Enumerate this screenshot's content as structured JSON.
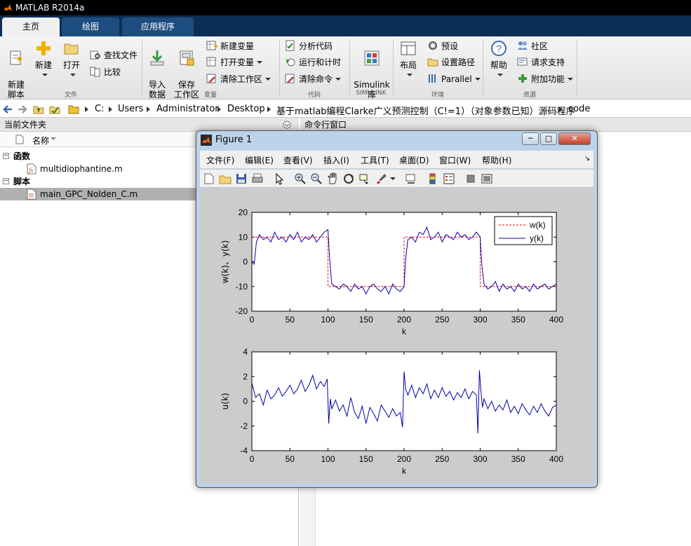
{
  "app": {
    "title": "MATLAB R2014a"
  },
  "tabs": [
    {
      "label": "主页"
    },
    {
      "label": "绘图"
    },
    {
      "label": "应用程序"
    }
  ],
  "ribbon": {
    "groups": {
      "file": "文件",
      "variable": "变量",
      "code": "代码",
      "simulink": "SIMULINK",
      "env": "环境",
      "resources": "资源"
    },
    "new_script": "新建\n脚本",
    "new": "新建",
    "open": "打开",
    "find_files": "查找文件",
    "compare": "比较",
    "import_data": "导入\n数据",
    "save_workspace": "保存\n工作区",
    "new_variable": "新建变量",
    "open_variable": "打开变量",
    "clear_workspace": "清除工作区",
    "analyze_code": "分析代码",
    "run_and_time": "运行和计时",
    "clear_commands": "清除命令",
    "simulink_library": "Simulink\n库",
    "layout": "布局",
    "preferences": "预设",
    "set_path": "设置路径",
    "parallel": "Parallel",
    "help": "帮助",
    "community": "社区",
    "request_support": "请求支持",
    "add_ons": "附加功能"
  },
  "address": {
    "crumbs": [
      "C:",
      "Users",
      "Administrator",
      "Desktop",
      "基于matlab编程Clarke广义预测控制（C!=1）（对象参数已知）源码程序",
      "code"
    ]
  },
  "current_folder": {
    "title": "当前文件夹",
    "col_name": "名称",
    "groups": [
      {
        "label": "函数",
        "files": [
          "multidiophantine.m"
        ]
      },
      {
        "label": "脚本",
        "files": [
          "main_GPC_NoIden_C.m"
        ]
      }
    ]
  },
  "command_window": {
    "title": "命令行窗口"
  },
  "figure": {
    "title": "Figure 1",
    "menus": [
      "文件(F)",
      "编辑(E)",
      "查看(V)",
      "插入(I)",
      "工具(T)",
      "桌面(D)",
      "窗口(W)",
      "帮助(H)"
    ]
  },
  "colors": {
    "tab_bar": "#0b2e55",
    "series_w": "#ff0000",
    "series_y": "#0000aa",
    "series_u": "#0000aa"
  },
  "chart_data": [
    {
      "type": "line",
      "xlabel": "k",
      "ylabel": "w(k)、y(k)",
      "xlim": [
        0,
        400
      ],
      "ylim": [
        -20,
        20
      ],
      "xticks": [
        0,
        50,
        100,
        150,
        200,
        250,
        300,
        350,
        400
      ],
      "yticks": [
        -20,
        -10,
        0,
        10,
        20
      ],
      "legend": "top-right",
      "series": [
        {
          "name": "w(k)",
          "style": "dashed",
          "color": "#ff0000",
          "x": [
            0,
            100,
            100,
            200,
            200,
            300,
            300,
            400
          ],
          "values": [
            10,
            10,
            -10,
            -10,
            10,
            10,
            -10,
            -10
          ]
        },
        {
          "name": "y(k)",
          "style": "solid",
          "color": "#0000aa",
          "x": [
            0,
            3,
            6,
            10,
            15,
            20,
            25,
            30,
            35,
            40,
            45,
            50,
            55,
            60,
            65,
            70,
            75,
            80,
            85,
            90,
            95,
            100,
            102,
            105,
            110,
            115,
            120,
            125,
            130,
            135,
            140,
            145,
            150,
            155,
            160,
            165,
            170,
            175,
            180,
            185,
            190,
            195,
            200,
            202,
            205,
            210,
            215,
            220,
            225,
            230,
            235,
            240,
            245,
            250,
            255,
            260,
            265,
            270,
            275,
            280,
            285,
            290,
            295,
            300,
            302,
            305,
            310,
            315,
            320,
            325,
            330,
            335,
            340,
            345,
            350,
            355,
            360,
            365,
            370,
            375,
            380,
            385,
            390,
            395,
            400
          ],
          "values": [
            0,
            -1,
            8,
            11,
            9,
            10,
            8,
            12,
            9,
            10,
            8,
            11,
            9,
            12,
            8,
            10,
            9,
            11,
            8,
            10,
            12,
            13,
            2,
            -9,
            -10,
            -11,
            -9,
            -10,
            -12,
            -9,
            -11,
            -10,
            -13,
            -10,
            -9,
            -11,
            -12,
            -10,
            -13,
            -9,
            -11,
            -12,
            -10,
            1,
            9,
            10,
            8,
            12,
            11,
            14,
            9,
            10,
            12,
            8,
            11,
            10,
            9,
            12,
            10,
            11,
            9,
            10,
            12,
            10,
            -1,
            -9,
            -11,
            -10,
            -8,
            -12,
            -9,
            -11,
            -10,
            -12,
            -9,
            -11,
            -10,
            -12,
            -9,
            -11,
            -10,
            -9,
            -11,
            -10,
            -9
          ]
        }
      ]
    },
    {
      "type": "line",
      "xlabel": "k",
      "ylabel": "u(k)",
      "xlim": [
        0,
        400
      ],
      "ylim": [
        -4,
        4
      ],
      "xticks": [
        0,
        50,
        100,
        150,
        200,
        250,
        300,
        350,
        400
      ],
      "yticks": [
        -4,
        -2,
        0,
        2,
        4
      ],
      "series": [
        {
          "color": "#0000aa",
          "x": [
            0,
            5,
            10,
            15,
            20,
            25,
            30,
            35,
            40,
            45,
            50,
            55,
            60,
            65,
            70,
            75,
            80,
            85,
            90,
            95,
            99,
            101,
            103,
            105,
            110,
            115,
            120,
            125,
            130,
            135,
            140,
            145,
            150,
            155,
            160,
            165,
            170,
            175,
            180,
            185,
            190,
            195,
            198,
            200,
            202,
            205,
            210,
            215,
            220,
            225,
            230,
            235,
            240,
            245,
            250,
            255,
            260,
            265,
            270,
            275,
            280,
            285,
            290,
            295,
            297,
            299,
            301,
            303,
            305,
            310,
            315,
            320,
            325,
            330,
            335,
            340,
            345,
            350,
            355,
            360,
            365,
            370,
            375,
            380,
            385,
            390,
            395,
            400
          ],
          "values": [
            1.5,
            0.3,
            0.6,
            -0.3,
            0.9,
            0.2,
            0.5,
            1.1,
            0.4,
            0.8,
            1.3,
            0.6,
            1.0,
            1.7,
            0.8,
            1.3,
            2.1,
            1.0,
            1.6,
            1.2,
            1.8,
            -1.8,
            0.2,
            -0.6,
            0.1,
            -0.8,
            -0.3,
            -1.2,
            0.3,
            -0.9,
            -1.4,
            -0.4,
            -1.8,
            -0.5,
            -1.0,
            -1.6,
            -0.3,
            -0.8,
            -1.3,
            -0.6,
            -1.2,
            -0.9,
            -2.1,
            2.4,
            1.0,
            0.5,
            1.3,
            0.3,
            1.1,
            0.6,
            1.4,
            0.2,
            0.9,
            0.3,
            1.1,
            0.4,
            0.8,
            0.1,
            0.7,
            0.3,
            1.0,
            0.2,
            0.8,
            0.5,
            -2.6,
            2.5,
            0.8,
            -0.5,
            0.2,
            -0.6,
            0.0,
            -0.8,
            -0.3,
            -0.7,
            0.1,
            -0.9,
            -0.4,
            -1.0,
            -0.2,
            -0.7,
            -1.1,
            -0.4,
            -0.9,
            -0.2,
            -0.8,
            -1.2,
            -0.5,
            -0.3
          ]
        }
      ]
    }
  ]
}
